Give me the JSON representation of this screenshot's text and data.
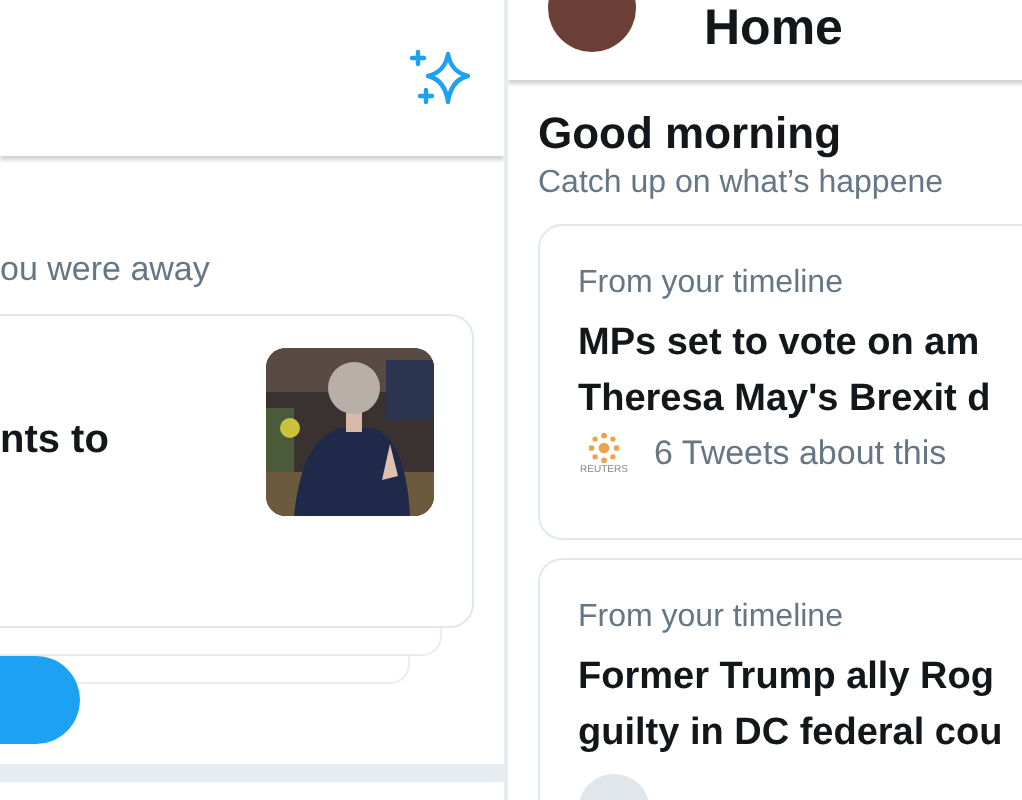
{
  "left_screen": {
    "section_subtitle": "ou were away",
    "story_card": {
      "title": "nts to"
    }
  },
  "right_screen": {
    "header": {
      "title": "Home"
    },
    "greeting": "Good morning",
    "subtitle": "Catch up on what’s happene",
    "cards": [
      {
        "label": "From your timeline",
        "headline": [
          "MPs set to vote on am",
          "Theresa May's Brexit d"
        ],
        "source": "REUTERS",
        "meta": "6 Tweets about this"
      },
      {
        "label": "From your timeline",
        "headline": [
          "Former Trump ally Rog",
          "guilty in DC federal cou"
        ]
      }
    ]
  }
}
